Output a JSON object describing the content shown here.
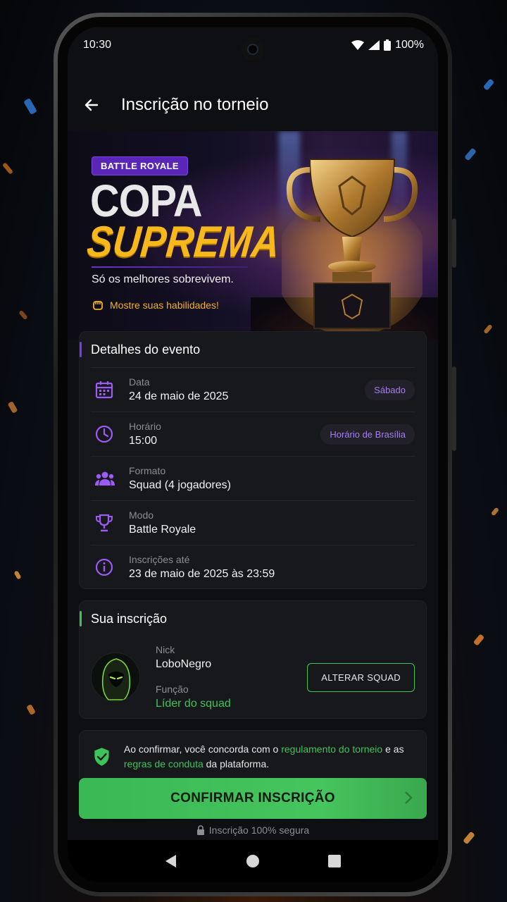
{
  "status_bar": {
    "time": "10:30",
    "battery": "100%"
  },
  "app_bar": {
    "title": "Inscrição no torneio"
  },
  "banner": {
    "tag": "BATTLE ROYALE",
    "title_line1": "COPA",
    "title_line2": "SUPREMA",
    "tagline": "Só os melhores sobrevivem.",
    "skill": "Mostre suas habilidades!"
  },
  "event_details": {
    "heading": "Detalhes do evento",
    "rows": [
      {
        "icon": "calendar-icon",
        "label": "Data",
        "value": "24 de maio de 2025",
        "pill": "Sábado"
      },
      {
        "icon": "clock-icon",
        "label": "Horário",
        "value": "15:00",
        "pill": "Horário de Brasília"
      },
      {
        "icon": "group-icon",
        "label": "Formato",
        "value": "Squad (4 jogadores)"
      },
      {
        "icon": "trophy-icon",
        "label": "Modo",
        "value": "Battle Royale"
      },
      {
        "icon": "info-icon",
        "label": "Inscrições até",
        "value": "23 de maio de 2025 às 23:59"
      }
    ]
  },
  "registration": {
    "heading": "Sua inscrição",
    "nick_label": "Nick",
    "nick": "LoboNegro",
    "role_label": "Função",
    "role": "Líder do squad",
    "change_button": "ALTERAR SQUAD"
  },
  "terms": {
    "part1": "Ao confirmar, você concorda com o ",
    "link1": "regulamento do torneio",
    "part2": " e as ",
    "link2": "regras de conduta",
    "part3": " da plataforma."
  },
  "confirm_button": "CONFIRMAR INSCRIÇÃO",
  "secure_note": "Inscrição 100% segura",
  "colors": {
    "accent_purple": "#7c3aed",
    "accent_green": "#3ec35a",
    "gold": "#f7b81c",
    "card_bg": "#17181c"
  }
}
